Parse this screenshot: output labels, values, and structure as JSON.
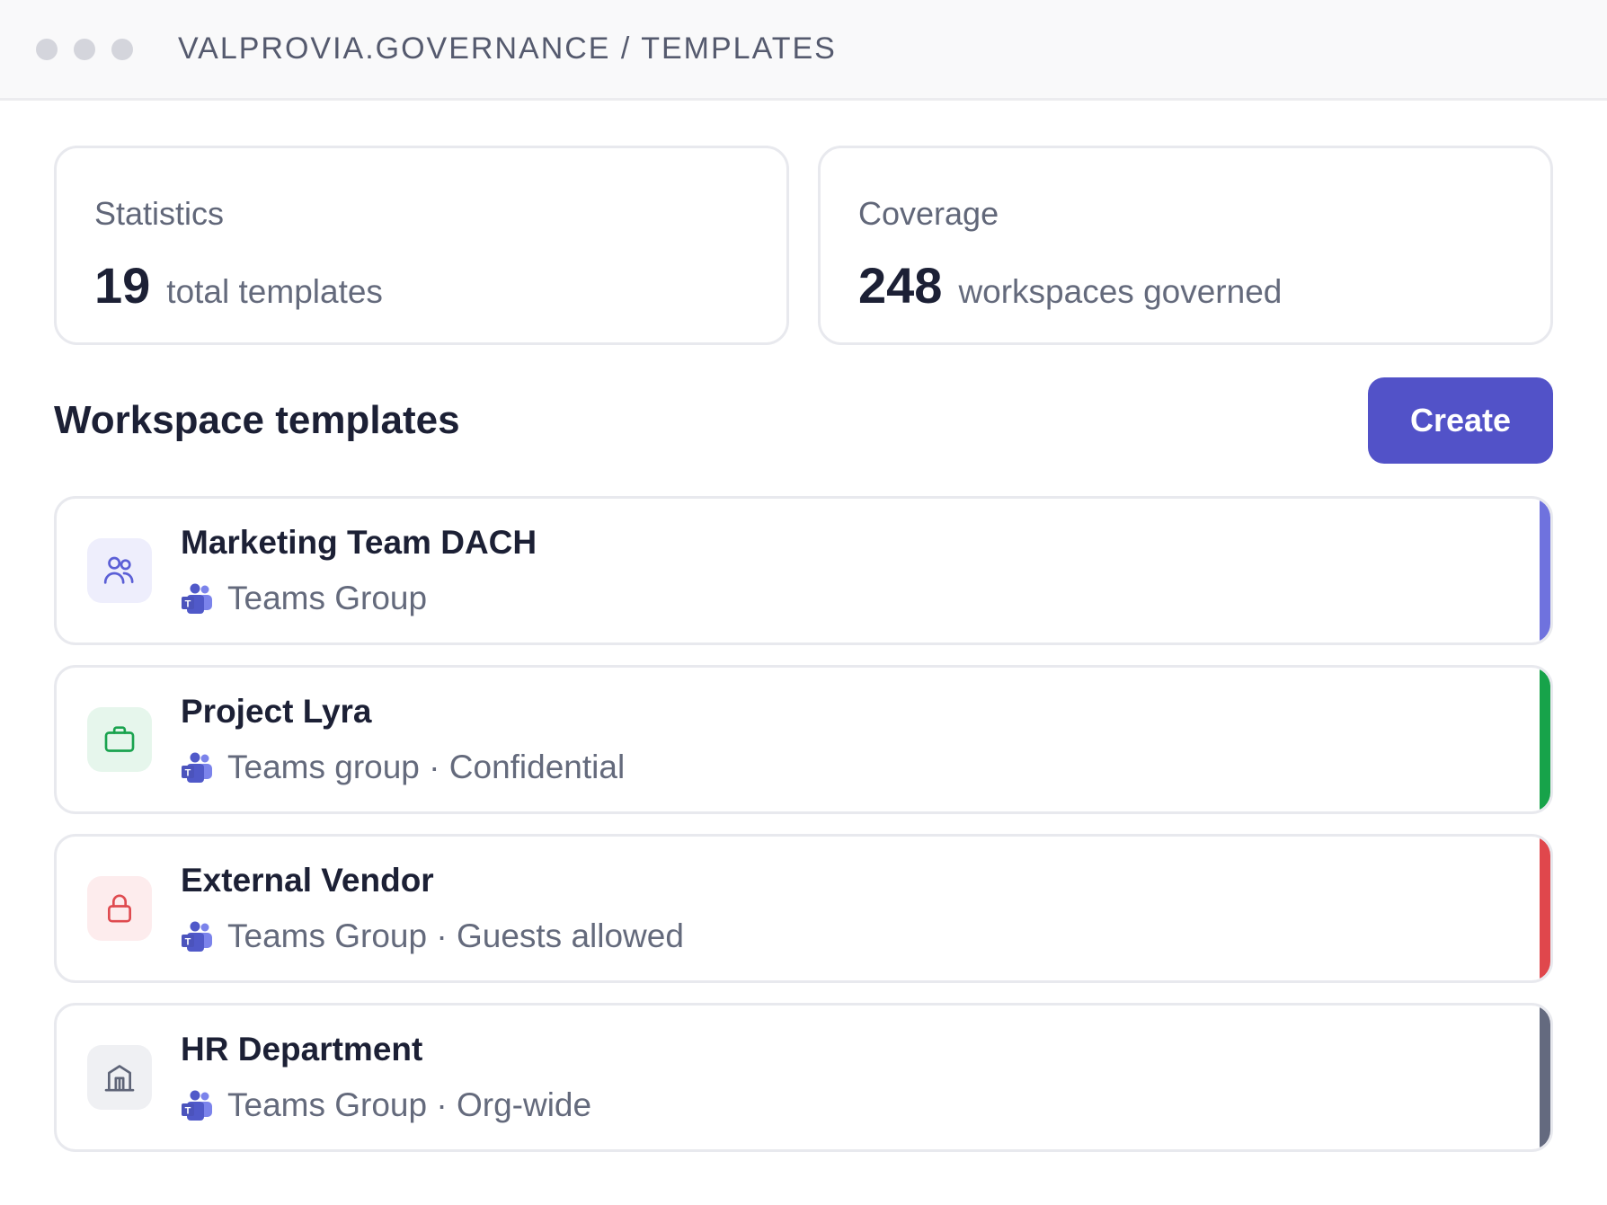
{
  "titlebar": {
    "path": "VALPROVIA.GOVERNANCE / TEMPLATES"
  },
  "stats": [
    {
      "label": "Statistics",
      "value": "19",
      "unit": "total templates"
    },
    {
      "label": "Coverage",
      "value": "248",
      "unit": "workspaces governed"
    }
  ],
  "section": {
    "title": "Workspace templates",
    "create_label": "Create"
  },
  "templates": [
    {
      "name": "Marketing Team DACH",
      "meta": "Teams Group",
      "icon": "users-icon",
      "accent": "#6f72de",
      "tile_bg": "#eeeefc",
      "icon_color": "#5b5fd6"
    },
    {
      "name": "Project Lyra",
      "meta": "Teams group · Confidential",
      "icon": "briefcase-icon",
      "accent": "#17a34a",
      "tile_bg": "#e6f6ec",
      "icon_color": "#1aa34f"
    },
    {
      "name": "External Vendor",
      "meta": "Teams Group · Guests allowed",
      "icon": "lock-icon",
      "accent": "#e0474c",
      "tile_bg": "#fdeced",
      "icon_color": "#df4b50"
    },
    {
      "name": "HR Department",
      "meta": "Teams Group · Org-wide",
      "icon": "building-icon",
      "accent": "#646a7f",
      "tile_bg": "#eff0f3",
      "icon_color": "#5e6477"
    }
  ]
}
